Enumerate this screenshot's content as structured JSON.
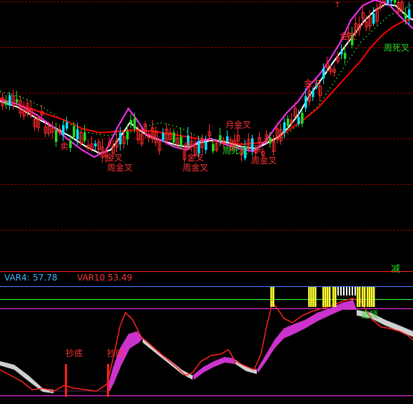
{
  "main": {
    "signals": {
      "golden_cross": "金叉",
      "month_golden_cross": "月金叉",
      "week_golden_cross": "周金叉",
      "week_death_cross": "周死叉",
      "sell_short": "卖",
      "buy_short": "买"
    },
    "minus_marker": "减",
    "top_marker": "T"
  },
  "indicator": {
    "var4_label": "VAR4:",
    "var4_value": "57.78",
    "var10_label": "VAR10",
    "var10_value": "53.49",
    "bottom_label_1": "抄底",
    "bottom_label_2": "抄底",
    "top_label": "逃顶"
  },
  "colors": {
    "up_candle": "#ff2a2a",
    "down_candle": "#00e5ff",
    "green_candle": "#22dd22",
    "ma_white": "#ffffff",
    "ma_magenta": "#ff33ff",
    "ma_red": "#ff0000",
    "dotted_green": "#22dd22",
    "signal_yellow": "#ffff33",
    "ribbon_magenta": "#cc33cc",
    "ribbon_gray": "#cfcfcf"
  }
}
